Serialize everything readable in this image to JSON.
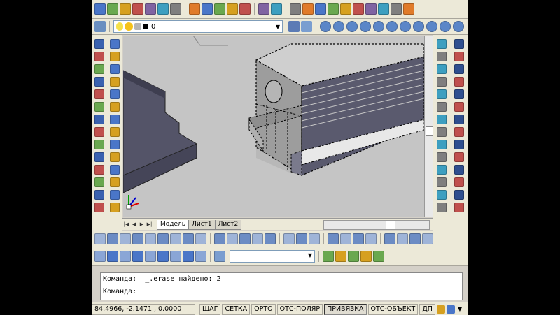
{
  "toolbar": {
    "layer_name": "0",
    "standard_icons": [
      "new-icon",
      "open-icon",
      "save-icon",
      "print-icon",
      "preview-icon",
      "publish-icon",
      "plot-icon",
      "cut-icon",
      "copy-icon",
      "paste-icon",
      "matchprop-icon",
      "blockeditor-icon",
      "undo-icon",
      "redo-icon",
      "pan-icon",
      "zoom-realtime-icon",
      "zoom-window-icon",
      "zoom-previous-icon",
      "properties-icon",
      "design-center-icon",
      "tool-palettes-icon",
      "sheet-set-icon",
      "markup-icon",
      "calculator-icon"
    ],
    "zoom_icons": [
      "zoom-in-icon",
      "zoom-out-icon",
      "zoom-all-icon",
      "zoom-extents-icon",
      "zoom-dynamic-icon",
      "zoom-scale-icon",
      "zoom-center-icon",
      "zoom-object-icon",
      "zoom-in2-icon",
      "zoom-out2-icon",
      "zoom-window2-icon"
    ]
  },
  "layout_tabs": [
    "Модель",
    "Лист1",
    "Лист2"
  ],
  "command": {
    "history": "Команда:  _.erase найдено: 2",
    "prompt": "Команда:"
  },
  "status": {
    "coords": "84.4966, -2.1471 , 0.0000",
    "buttons": [
      {
        "label": "ШАГ",
        "on": false
      },
      {
        "label": "СЕТКА",
        "on": false
      },
      {
        "label": "ОРТО",
        "on": false
      },
      {
        "label": "ОТС-ПОЛЯР",
        "on": false
      },
      {
        "label": "ПРИВЯЗКА",
        "on": true
      },
      {
        "label": "ОТС-ОБЪЕКТ",
        "on": false
      },
      {
        "label": "ДП",
        "on": false
      }
    ]
  },
  "colors": {
    "workspace": "#c5c5c5",
    "solid_face": "#545468",
    "toolbar": "#ece9d8"
  }
}
